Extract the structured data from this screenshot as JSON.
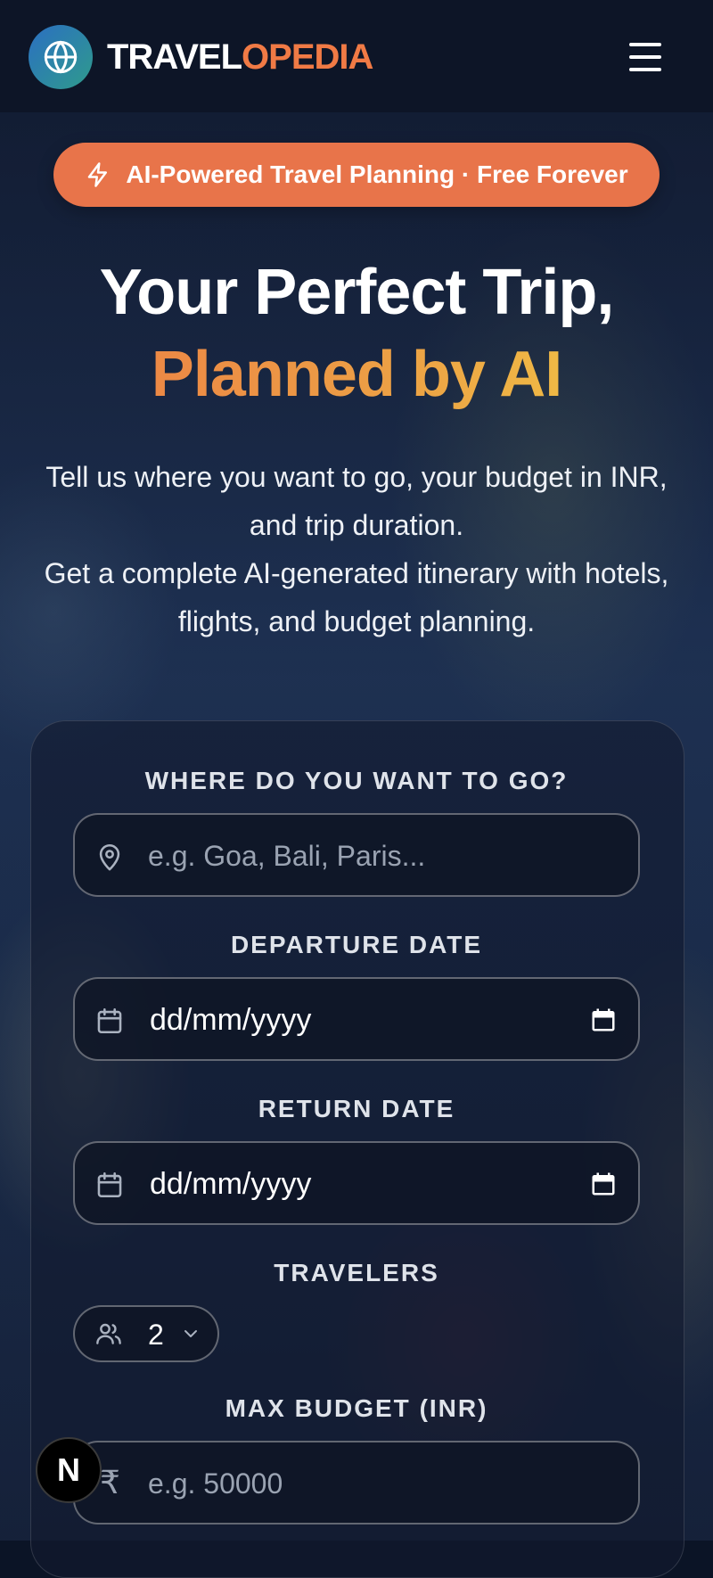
{
  "header": {
    "brand_part1": "TRAVEL",
    "brand_part2": "OPEDIA",
    "logo_icon": "globe-icon",
    "menu_icon": "hamburger-menu-icon"
  },
  "hero": {
    "pill_text": "AI-Powered Travel Planning · Free Forever",
    "pill_icon": "lightning-icon",
    "headline_line1": "Your Perfect Trip,",
    "headline_line2": "Planned by AI",
    "subtext_line1": "Tell us where you want to go, your budget in INR, and trip duration.",
    "subtext_line2": "Get a complete AI-generated itinerary with hotels, flights, and budget planning."
  },
  "form": {
    "destination": {
      "label": "WHERE DO YOU WANT TO GO?",
      "placeholder": "e.g. Goa, Bali, Paris...",
      "value": ""
    },
    "departure": {
      "label": "DEPARTURE DATE",
      "value": "dd/mm/yyyy"
    },
    "return_date": {
      "label": "RETURN DATE",
      "value": "dd/mm/yyyy"
    },
    "travelers": {
      "label": "TRAVELERS",
      "value": "2"
    },
    "budget": {
      "label": "MAX BUDGET (INR)",
      "placeholder": "e.g. 50000",
      "currency_symbol": "₹",
      "value": ""
    }
  },
  "badge": {
    "letter": "N"
  },
  "colors": {
    "accent": "#e8744a",
    "brand_orange": "#f07a45",
    "header_bg": "#0d1527",
    "gradient_start": "#ec7a45",
    "gradient_end": "#f2cf45"
  }
}
